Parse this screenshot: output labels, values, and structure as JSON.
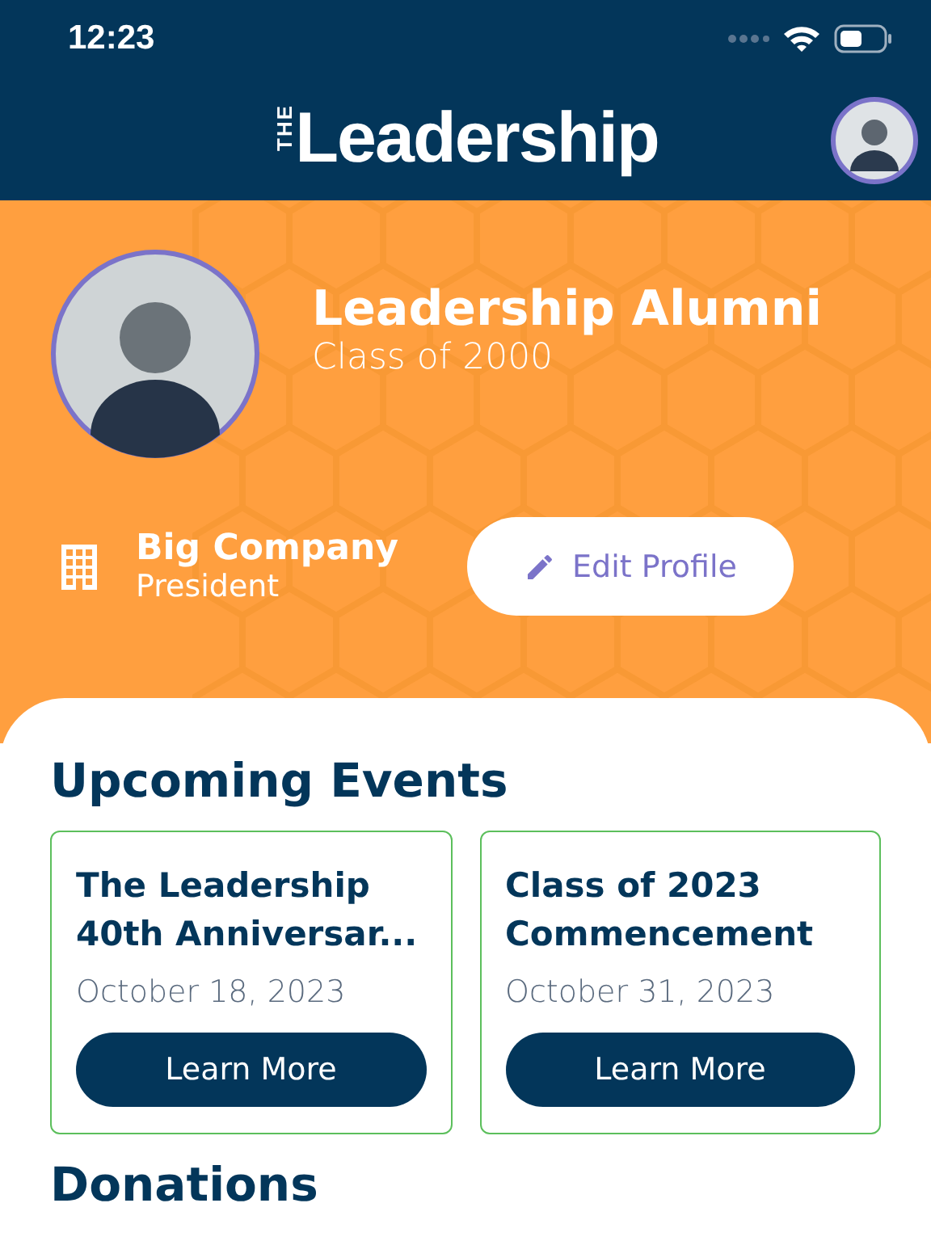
{
  "status_bar": {
    "time": "12:23"
  },
  "header": {
    "logo_small": "THE",
    "logo_main": "Leadership"
  },
  "profile": {
    "name": "Leadership Alumni",
    "class": "Class of 2000",
    "company": "Big Company",
    "position": "President",
    "edit_button": "Edit Profile"
  },
  "events": {
    "title": "Upcoming Events",
    "items": [
      {
        "title": "The Leadership 40th Anniversar...",
        "date": "October 18, 2023",
        "button": "Learn More"
      },
      {
        "title": "Class of 2023 Commencement",
        "date": "October 31, 2023",
        "button": "Learn More"
      }
    ]
  },
  "donations": {
    "title": "Donations"
  }
}
